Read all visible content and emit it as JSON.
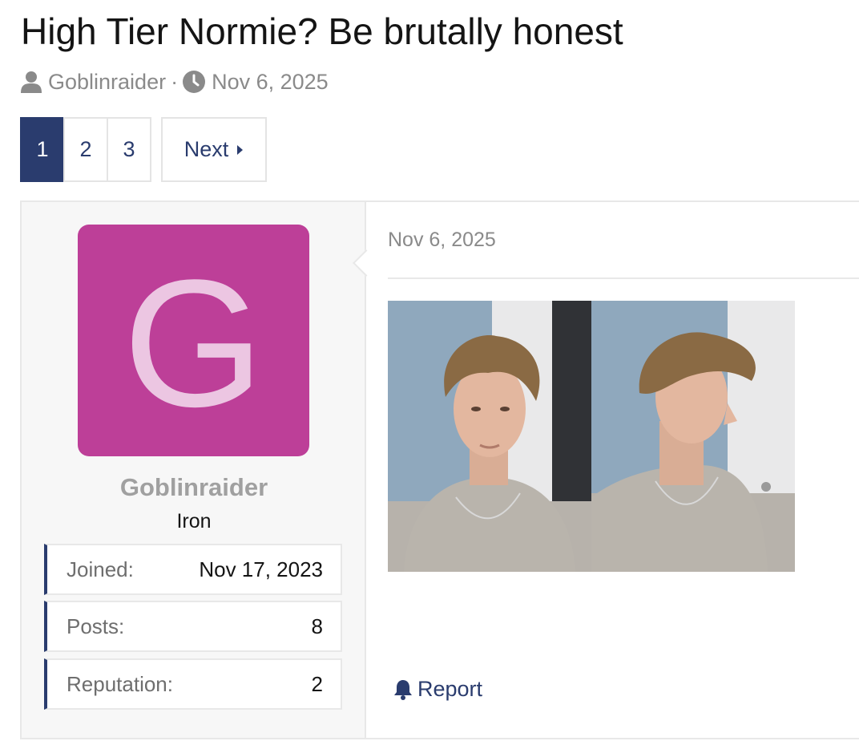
{
  "thread": {
    "title": "High Tier Normie? Be brutally honest",
    "author": "Goblinraider",
    "separator": "·",
    "date": "Nov 6, 2025"
  },
  "pagination": {
    "pages": [
      "1",
      "2",
      "3"
    ],
    "current": "1",
    "next_label": "Next"
  },
  "post": {
    "user": {
      "avatar_letter": "G",
      "avatar_color": "#bd3f98",
      "username": "Goblinraider",
      "user_title": "Iron",
      "stats": [
        {
          "label": "Joined:",
          "value": "Nov 17, 2023"
        },
        {
          "label": "Posts:",
          "value": "8"
        },
        {
          "label": "Reputation:",
          "value": "2"
        }
      ]
    },
    "date": "Nov 6, 2025",
    "attachments": [
      "photo-front",
      "photo-profile"
    ],
    "report_label": "Report"
  },
  "colors": {
    "accent": "#2a3c6e",
    "avatar_bg": "#bd3f98",
    "avatar_letter": "#ecc6e2",
    "muted_text": "#8a8a8a"
  },
  "icons": {
    "author": "user-icon",
    "date": "clock-icon",
    "next": "caret-right-icon",
    "report": "bell-icon"
  }
}
